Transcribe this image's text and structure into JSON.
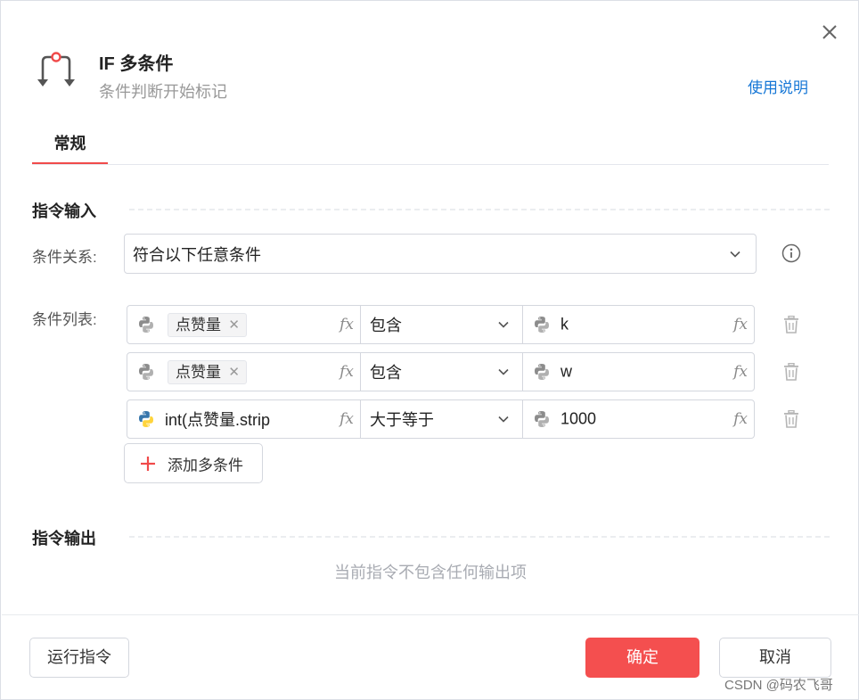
{
  "header": {
    "title": "IF 多条件",
    "subtitle": "条件判断开始标记",
    "help_link": "使用说明"
  },
  "tabs": [
    {
      "label": "常规",
      "active": true
    }
  ],
  "input_section": {
    "title": "指令输入",
    "relation_label": "条件关系:",
    "relation_value": "符合以下任意条件",
    "list_label": "条件列表:",
    "conditions": [
      {
        "left_tag": "点赞量",
        "left_icon": "python-gray-icon",
        "operator": "包含",
        "right_icon": "python-gray-icon",
        "right_value": "k"
      },
      {
        "left_tag": "点赞量",
        "left_icon": "python-gray-icon",
        "operator": "包含",
        "right_icon": "python-gray-icon",
        "right_value": "w"
      },
      {
        "left_text": "int(点赞量.strip",
        "left_icon": "python-color-icon",
        "operator": "大于等于",
        "right_icon": "python-gray-icon",
        "right_value": "1000"
      }
    ],
    "fx_label": "fx",
    "add_button": "添加多条件"
  },
  "output_section": {
    "title": "指令输出",
    "empty_text": "当前指令不包含任何输出项"
  },
  "footer": {
    "run_button": "运行指令",
    "ok_button": "确定",
    "cancel_button": "取消"
  },
  "watermark": "CSDN @码农飞哥",
  "colors": {
    "accent": "#f44f4f",
    "link": "#1677d6",
    "muted": "#999999",
    "python_blue": "#3776ab",
    "python_yellow": "#ffd43b"
  }
}
